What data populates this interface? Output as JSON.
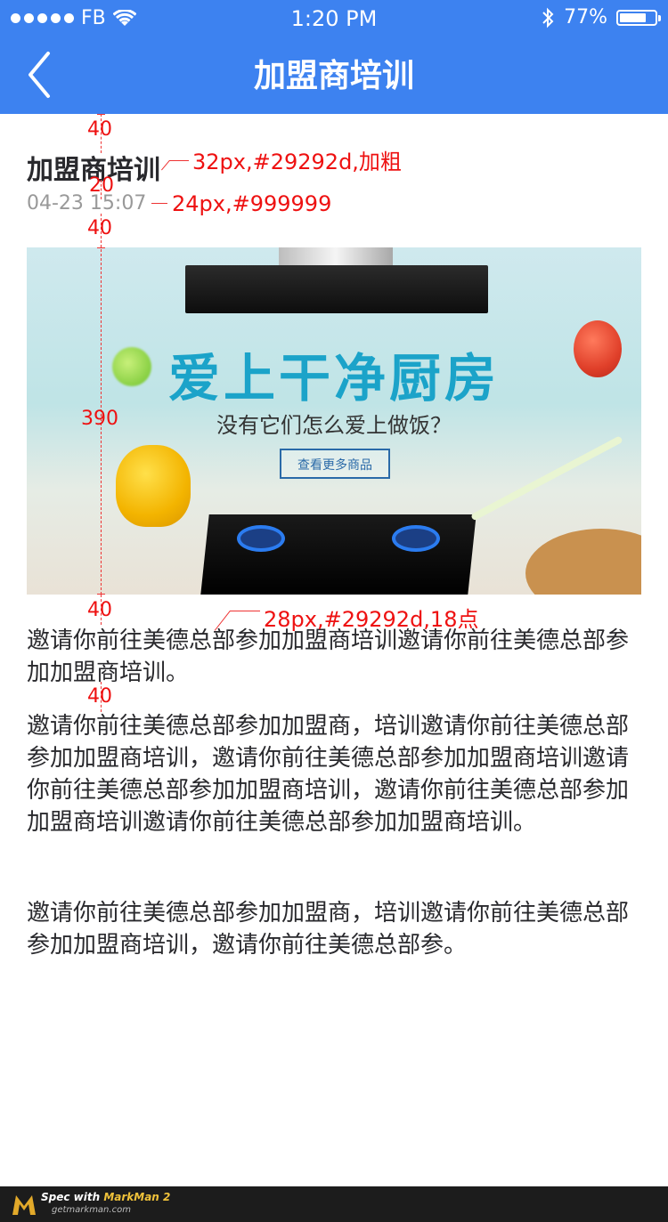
{
  "status_bar": {
    "carrier": "FB",
    "time": "1:20 PM",
    "battery_percent": "77%",
    "battery_level": 0.77
  },
  "nav": {
    "title": "加盟商培训",
    "back_icon": "chevron-left-icon"
  },
  "article": {
    "title": "加盟商培训",
    "time": "04-23 15:07",
    "banner": {
      "headline": "爱上干净厨房",
      "subline": "没有它们怎么爱上做饭？",
      "button_label": "查看更多商品"
    },
    "paragraphs": [
      "邀请你前往美德总部参加加盟商培训邀请你前往美德总部参加加盟商培训。",
      "邀请你前往美德总部参加加盟商，培训邀请你前往美德总部参加加盟商培训，邀请你前往美德总部参加加盟商培训邀请你前往美德总部参加加盟商培训，邀请你前往美德总部参加加盟商培训邀请你前往美德总部参加加盟商培训。",
      "邀请你前往美德总部参加加盟商，培训邀请你前往美德总部参加加盟商培训，邀请你前往美德总部参。"
    ]
  },
  "spec_annotations": {
    "gap_top": "40",
    "title_spec": "32px,#29292d,加粗",
    "gap_title_time": "20",
    "time_spec": "24px,#999999",
    "gap_time_banner": "40",
    "banner_height": "390",
    "gap_banner_text": "40",
    "body_spec": "28px,#29292d,18点",
    "gap_paragraph": "40"
  },
  "footer": {
    "line1_prefix": "Spec with ",
    "line1_brand": "MarkMan 2",
    "line2": "getmarkman.com"
  },
  "colors": {
    "nav_bg": "#3d82f0",
    "title": "#29292d",
    "time": "#999999",
    "annotation": "#ee1111"
  }
}
